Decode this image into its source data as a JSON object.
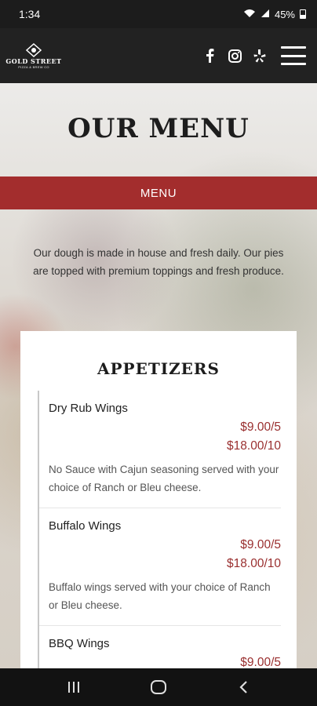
{
  "status": {
    "time": "1:34",
    "battery": "45%"
  },
  "header": {
    "logo_line1": "GOLD STREET",
    "logo_line2": "PIZZA & BREW CO",
    "social": [
      "facebook-icon",
      "instagram-icon",
      "yelp-icon"
    ]
  },
  "hero": {
    "title": "OUR MENU"
  },
  "menu_bar": {
    "label": "MENU"
  },
  "intro": {
    "text": "Our dough is made in house and fresh daily. Our pies are topped with premium toppings and fresh produce."
  },
  "section": {
    "title": "APPETIZERS",
    "items": [
      {
        "name": "Dry Rub Wings",
        "price1": "$9.00/5",
        "price2": "$18.00/10",
        "desc": "No Sauce with Cajun seasoning served with your choice of Ranch or Bleu cheese."
      },
      {
        "name": "Buffalo Wings",
        "price1": "$9.00/5",
        "price2": "$18.00/10",
        "desc": "Buffalo wings served with your choice of Ranch or Bleu cheese."
      },
      {
        "name": "BBQ Wings",
        "price1": "$9.00/5",
        "price2": "",
        "desc": ""
      }
    ]
  },
  "colors": {
    "accent": "#a32d2d",
    "price": "#9a2f2f",
    "header": "#222222"
  }
}
